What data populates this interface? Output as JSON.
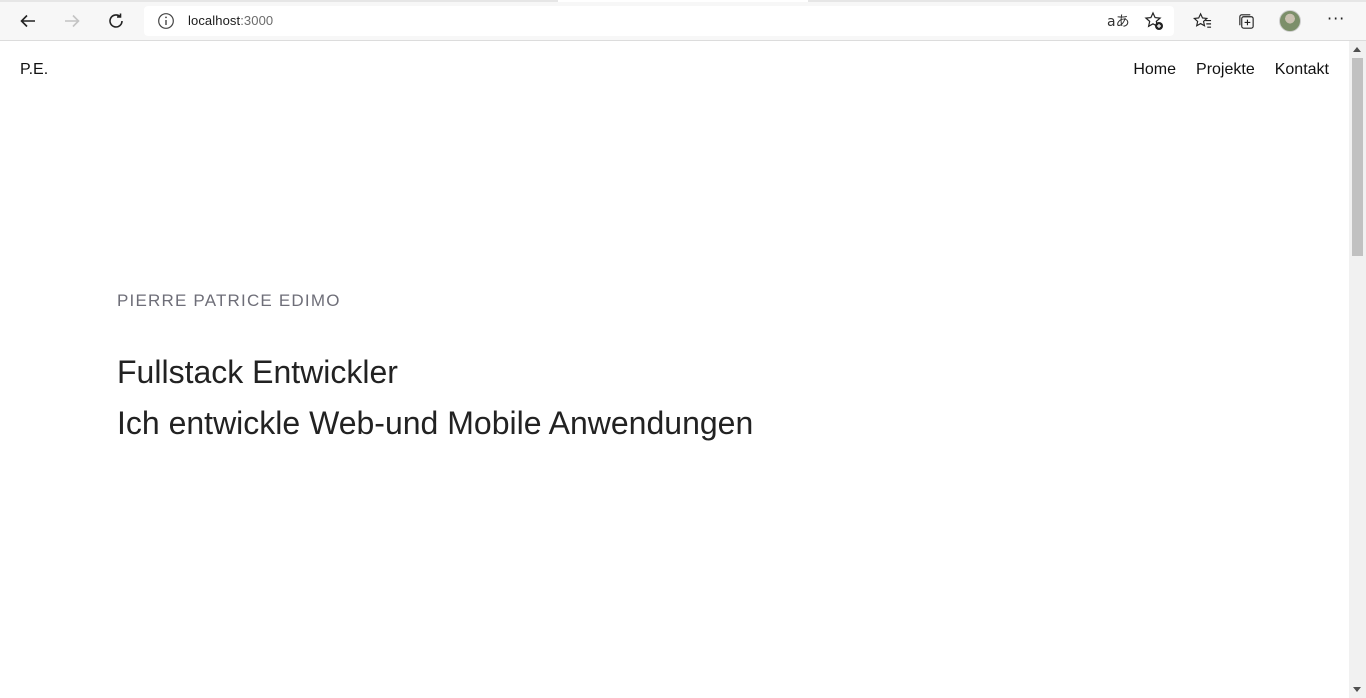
{
  "browser": {
    "address": "localhost",
    "port": ":3000",
    "translate_glyph": "aあ",
    "more_glyph": "···"
  },
  "site": {
    "logo": "P.E.",
    "nav": [
      {
        "label": "Home"
      },
      {
        "label": "Projekte"
      },
      {
        "label": "Kontakt"
      }
    ]
  },
  "hero": {
    "name": "PIERRE PATRICE EDIMO",
    "role": "Fullstack Entwickler",
    "tagline": "Ich entwickle Web-und Mobile Anwendungen"
  }
}
